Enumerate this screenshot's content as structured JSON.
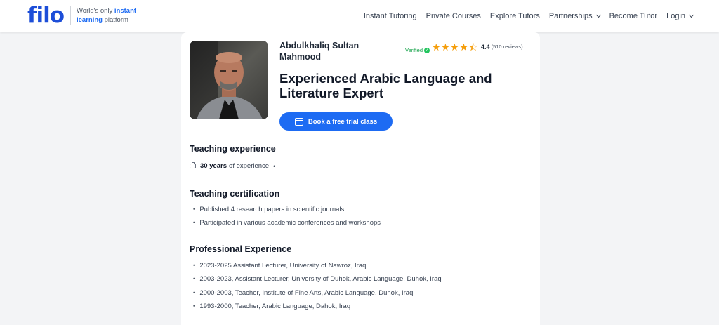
{
  "header": {
    "logo": "filo",
    "tagline_prefix": "World's only ",
    "tagline_highlight1": "instant",
    "tagline_highlight2": "learning",
    "tagline_suffix": " platform",
    "nav": [
      {
        "label": "Instant Tutoring"
      },
      {
        "label": "Private Courses"
      },
      {
        "label": "Explore Tutors"
      },
      {
        "label": "Partnerships"
      },
      {
        "label": "Become Tutor"
      },
      {
        "label": "Login"
      }
    ]
  },
  "tutor": {
    "name": "Abdulkhaliq Sultan Mahmood",
    "verified": "Verified",
    "rating": "4.4",
    "rating_value": 4.4,
    "reviews": "(510 reviews)",
    "headline": "Experienced Arabic Language and Literature Expert",
    "book_label": "Book a free trial class"
  },
  "teaching_experience": {
    "title": "Teaching experience",
    "years": "30 years",
    "suffix": "of experience"
  },
  "certification": {
    "title": "Teaching certification",
    "items": [
      "Published 4 research papers in scientific journals",
      "Participated in various academic conferences and workshops"
    ]
  },
  "professional": {
    "title": "Professional Experience",
    "items": [
      "2023-2025 Assistant Lecturer, University of Nawroz, Iraq",
      "2003-2023, Assistant Lecturer, University of Duhok, Arabic Language, Duhok, Iraq",
      "2000-2003, Teacher, Institute of Fine Arts, Arabic Language, Duhok, Iraq",
      "1993-2000, Teacher, Arabic Language, Dahok, Iraq"
    ]
  },
  "colors": {
    "brand": "#1d4ed8",
    "button": "#1d6bf3",
    "star": "#f59e0b",
    "verified": "#16a34a"
  }
}
